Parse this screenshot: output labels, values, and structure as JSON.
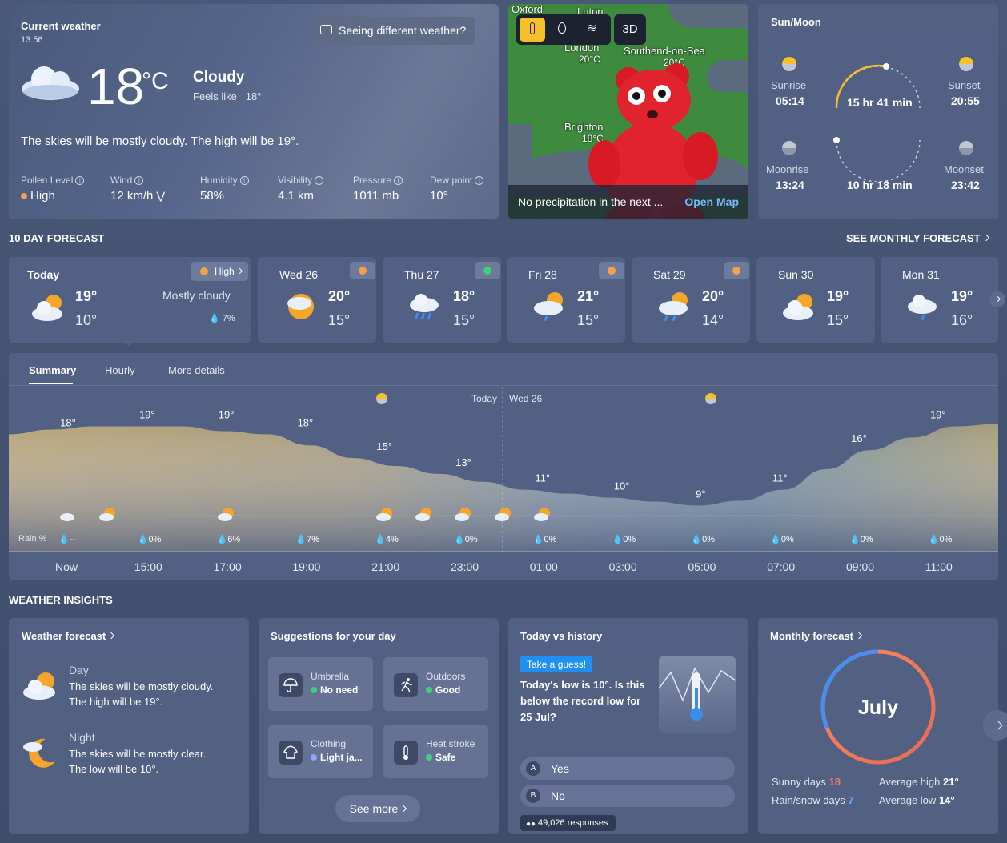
{
  "current": {
    "title": "Current weather",
    "time": "13:56",
    "temp": "18",
    "unit": "°C",
    "condition": "Cloudy",
    "feels_label": "Feels like",
    "feels": "18°",
    "summary": "The skies will be mostly cloudy. The high will be 19°.",
    "feedback_button": "Seeing different weather?",
    "stats": [
      {
        "label": "Pollen Level",
        "value": "High"
      },
      {
        "label": "Wind",
        "value": "12 km/h"
      },
      {
        "label": "Humidity",
        "value": "58%"
      },
      {
        "label": "Visibility",
        "value": "4.1 km"
      },
      {
        "label": "Pressure",
        "value": "1011 mb"
      },
      {
        "label": "Dew point",
        "value": "10°"
      }
    ]
  },
  "map": {
    "toggle_3d": "3D",
    "towns": [
      {
        "name": "Oxford",
        "temp": ""
      },
      {
        "name": "Luton",
        "temp": ""
      },
      {
        "name": "London",
        "temp": "20°C"
      },
      {
        "name": "Southend-on-Sea",
        "temp": "20°C"
      },
      {
        "name": "Brighton",
        "temp": "18°C"
      }
    ],
    "footer": "No precipitation in the next ...",
    "open_map": "Open Map"
  },
  "sunmoon": {
    "title": "Sun/Moon",
    "sunrise_label": "Sunrise",
    "sunrise": "05:14",
    "sunset_label": "Sunset",
    "sunset": "20:55",
    "day_length": "15 hr 41 min",
    "moonrise_label": "Moonrise",
    "moonrise": "13:24",
    "moonset_label": "Moonset",
    "moonset": "23:42",
    "moon_length": "10 hr 18 min"
  },
  "forecast": {
    "title": "10 DAY FORECAST",
    "monthly_link": "SEE MONTHLY FORECAST",
    "today": {
      "name": "Today",
      "badge": "High",
      "hi": "19°",
      "lo": "10°",
      "cond": "Mostly cloudy",
      "rain": "7%"
    },
    "days": [
      {
        "name": "Wed 26",
        "hi": "20°",
        "lo": "15°"
      },
      {
        "name": "Thu 27",
        "hi": "18°",
        "lo": "15°"
      },
      {
        "name": "Fri 28",
        "hi": "21°",
        "lo": "15°"
      },
      {
        "name": "Sat 29",
        "hi": "20°",
        "lo": "14°"
      },
      {
        "name": "Sun 30",
        "hi": "19°",
        "lo": "15°"
      },
      {
        "name": "Mon 31",
        "hi": "19°",
        "lo": "16°"
      }
    ]
  },
  "hourly": {
    "tabs": [
      "Summary",
      "Hourly",
      "More details"
    ],
    "today_label": "Today",
    "next_label": "Wed 26",
    "rain_label": "Rain %",
    "chart_data": {
      "type": "area",
      "x": [
        "Now",
        "",
        "15:00",
        "",
        "17:00",
        "",
        "19:00",
        "",
        "21:00",
        "",
        "23:00",
        "",
        "01:00",
        "",
        "03:00",
        "",
        "05:00",
        "",
        "07:00",
        "",
        "09:00",
        "",
        "11:00",
        ""
      ],
      "temps_shown": [
        {
          "i": 0,
          "v": 18
        },
        {
          "i": 2,
          "v": 19
        },
        {
          "i": 4,
          "v": 19
        },
        {
          "i": 6,
          "v": 18
        },
        {
          "i": 8,
          "v": 15
        },
        {
          "i": 10,
          "v": 13
        },
        {
          "i": 12,
          "v": 11
        },
        {
          "i": 14,
          "v": 10
        },
        {
          "i": 16,
          "v": 9
        },
        {
          "i": 18,
          "v": 11
        },
        {
          "i": 20,
          "v": 16
        },
        {
          "i": 22,
          "v": 19
        }
      ],
      "temps": [
        18,
        18.6,
        19,
        19,
        19,
        18.4,
        18,
        16.6,
        15,
        14,
        13,
        12,
        11,
        10.5,
        10,
        9.5,
        9,
        9.6,
        11,
        13.6,
        16,
        17.6,
        19,
        19.3
      ],
      "rain": [
        "--",
        "0%",
        "6%",
        "7%",
        "4%",
        "0%",
        "0%",
        "0%",
        "0%",
        "0%",
        "0%",
        "0%"
      ],
      "times": [
        "Now",
        "15:00",
        "17:00",
        "19:00",
        "21:00",
        "23:00",
        "01:00",
        "03:00",
        "05:00",
        "07:00",
        "09:00",
        "11:00"
      ]
    }
  },
  "insights": {
    "title": "WEATHER INSIGHTS",
    "forecast_card": {
      "title": "Weather forecast",
      "day_label": "Day",
      "day_text1": "The skies will be mostly cloudy.",
      "day_text2": "The high will be 19°.",
      "night_label": "Night",
      "night_text1": "The skies will be mostly clear.",
      "night_text2": "The low will be 10°."
    },
    "suggestions": {
      "title": "Suggestions for your day",
      "items": [
        {
          "name": "Umbrella",
          "status": "No need"
        },
        {
          "name": "Outdoors",
          "status": "Good"
        },
        {
          "name": "Clothing",
          "status": "Light ja..."
        },
        {
          "name": "Heat stroke",
          "status": "Safe"
        }
      ],
      "see_more": "See more"
    },
    "history": {
      "title": "Today vs history",
      "tag": "Take a guess!",
      "question": "Today's low is 10°. Is this below the record low for 25 Jul?",
      "q1": "Today's low is 10°. Is this",
      "q2": "below the record low for",
      "q3": "25 Jul?",
      "answers": [
        {
          "key": "A",
          "label": "Yes"
        },
        {
          "key": "B",
          "label": "No"
        }
      ],
      "responses": "49,026 responses"
    },
    "monthly": {
      "title": "Monthly forecast",
      "month": "July",
      "sunny_label": "Sunny days",
      "sunny": "18",
      "rain_label": "Rain/snow days",
      "rain": "7",
      "avg_high_label": "Average high",
      "avg_high": "21°",
      "avg_low_label": "Average low",
      "avg_low": "14°"
    }
  },
  "colors": {
    "accent_yellow": "#f5c02a",
    "pollen": "#f5a04a",
    "good": "#3fd07a",
    "blue_link": "#7ab8ff",
    "sunny": "#f47a6a",
    "rainy": "#6ab0ff"
  }
}
